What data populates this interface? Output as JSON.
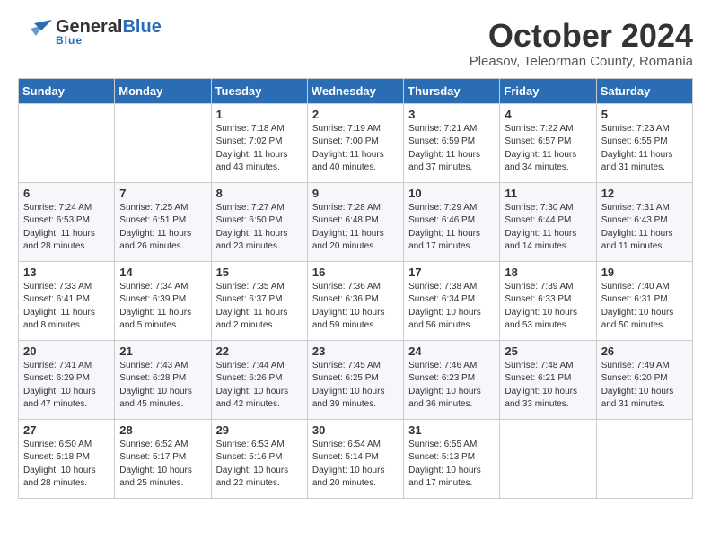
{
  "header": {
    "logo_general": "General",
    "logo_blue": "Blue",
    "month_title": "October 2024",
    "subtitle": "Pleasov, Teleorman County, Romania"
  },
  "weekdays": [
    "Sunday",
    "Monday",
    "Tuesday",
    "Wednesday",
    "Thursday",
    "Friday",
    "Saturday"
  ],
  "weeks": [
    [
      {
        "day": "",
        "info": ""
      },
      {
        "day": "",
        "info": ""
      },
      {
        "day": "1",
        "info": "Sunrise: 7:18 AM\nSunset: 7:02 PM\nDaylight: 11 hours and 43 minutes."
      },
      {
        "day": "2",
        "info": "Sunrise: 7:19 AM\nSunset: 7:00 PM\nDaylight: 11 hours and 40 minutes."
      },
      {
        "day": "3",
        "info": "Sunrise: 7:21 AM\nSunset: 6:59 PM\nDaylight: 11 hours and 37 minutes."
      },
      {
        "day": "4",
        "info": "Sunrise: 7:22 AM\nSunset: 6:57 PM\nDaylight: 11 hours and 34 minutes."
      },
      {
        "day": "5",
        "info": "Sunrise: 7:23 AM\nSunset: 6:55 PM\nDaylight: 11 hours and 31 minutes."
      }
    ],
    [
      {
        "day": "6",
        "info": "Sunrise: 7:24 AM\nSunset: 6:53 PM\nDaylight: 11 hours and 28 minutes."
      },
      {
        "day": "7",
        "info": "Sunrise: 7:25 AM\nSunset: 6:51 PM\nDaylight: 11 hours and 26 minutes."
      },
      {
        "day": "8",
        "info": "Sunrise: 7:27 AM\nSunset: 6:50 PM\nDaylight: 11 hours and 23 minutes."
      },
      {
        "day": "9",
        "info": "Sunrise: 7:28 AM\nSunset: 6:48 PM\nDaylight: 11 hours and 20 minutes."
      },
      {
        "day": "10",
        "info": "Sunrise: 7:29 AM\nSunset: 6:46 PM\nDaylight: 11 hours and 17 minutes."
      },
      {
        "day": "11",
        "info": "Sunrise: 7:30 AM\nSunset: 6:44 PM\nDaylight: 11 hours and 14 minutes."
      },
      {
        "day": "12",
        "info": "Sunrise: 7:31 AM\nSunset: 6:43 PM\nDaylight: 11 hours and 11 minutes."
      }
    ],
    [
      {
        "day": "13",
        "info": "Sunrise: 7:33 AM\nSunset: 6:41 PM\nDaylight: 11 hours and 8 minutes."
      },
      {
        "day": "14",
        "info": "Sunrise: 7:34 AM\nSunset: 6:39 PM\nDaylight: 11 hours and 5 minutes."
      },
      {
        "day": "15",
        "info": "Sunrise: 7:35 AM\nSunset: 6:37 PM\nDaylight: 11 hours and 2 minutes."
      },
      {
        "day": "16",
        "info": "Sunrise: 7:36 AM\nSunset: 6:36 PM\nDaylight: 10 hours and 59 minutes."
      },
      {
        "day": "17",
        "info": "Sunrise: 7:38 AM\nSunset: 6:34 PM\nDaylight: 10 hours and 56 minutes."
      },
      {
        "day": "18",
        "info": "Sunrise: 7:39 AM\nSunset: 6:33 PM\nDaylight: 10 hours and 53 minutes."
      },
      {
        "day": "19",
        "info": "Sunrise: 7:40 AM\nSunset: 6:31 PM\nDaylight: 10 hours and 50 minutes."
      }
    ],
    [
      {
        "day": "20",
        "info": "Sunrise: 7:41 AM\nSunset: 6:29 PM\nDaylight: 10 hours and 47 minutes."
      },
      {
        "day": "21",
        "info": "Sunrise: 7:43 AM\nSunset: 6:28 PM\nDaylight: 10 hours and 45 minutes."
      },
      {
        "day": "22",
        "info": "Sunrise: 7:44 AM\nSunset: 6:26 PM\nDaylight: 10 hours and 42 minutes."
      },
      {
        "day": "23",
        "info": "Sunrise: 7:45 AM\nSunset: 6:25 PM\nDaylight: 10 hours and 39 minutes."
      },
      {
        "day": "24",
        "info": "Sunrise: 7:46 AM\nSunset: 6:23 PM\nDaylight: 10 hours and 36 minutes."
      },
      {
        "day": "25",
        "info": "Sunrise: 7:48 AM\nSunset: 6:21 PM\nDaylight: 10 hours and 33 minutes."
      },
      {
        "day": "26",
        "info": "Sunrise: 7:49 AM\nSunset: 6:20 PM\nDaylight: 10 hours and 31 minutes."
      }
    ],
    [
      {
        "day": "27",
        "info": "Sunrise: 6:50 AM\nSunset: 5:18 PM\nDaylight: 10 hours and 28 minutes."
      },
      {
        "day": "28",
        "info": "Sunrise: 6:52 AM\nSunset: 5:17 PM\nDaylight: 10 hours and 25 minutes."
      },
      {
        "day": "29",
        "info": "Sunrise: 6:53 AM\nSunset: 5:16 PM\nDaylight: 10 hours and 22 minutes."
      },
      {
        "day": "30",
        "info": "Sunrise: 6:54 AM\nSunset: 5:14 PM\nDaylight: 10 hours and 20 minutes."
      },
      {
        "day": "31",
        "info": "Sunrise: 6:55 AM\nSunset: 5:13 PM\nDaylight: 10 hours and 17 minutes."
      },
      {
        "day": "",
        "info": ""
      },
      {
        "day": "",
        "info": ""
      }
    ]
  ]
}
